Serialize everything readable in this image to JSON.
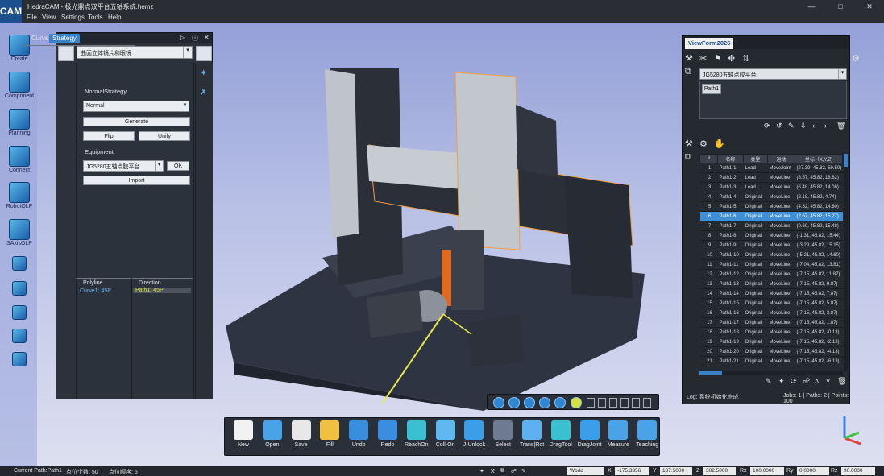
{
  "app": {
    "logo": "CAM",
    "title": "HedraCAM - 极光鼎点双平台五轴系统.hemz",
    "menu": [
      "File",
      "View",
      "Settings",
      "Tools",
      "Help"
    ]
  },
  "left_toolbar": {
    "items": [
      "Create",
      "Component",
      "Planning",
      "Connect",
      "RobotOLP",
      "SAxisOLP"
    ]
  },
  "strategy_panel": {
    "top_select": "曲面立体镜片和眼镜",
    "tabs": [
      "Curve",
      "Strategy"
    ],
    "active_tab": "Strategy",
    "normal_strategy_label": "NormalStrategy",
    "normal_value": "Normal",
    "generate_label": "Generate",
    "flip_label": "Flip",
    "unify_label": "Unify",
    "equipment_label": "Equipment",
    "equipment_value": "JG5280五轴点胶平台",
    "ok_label": "OK",
    "import_label": "Import",
    "polyline_header": "Polyline",
    "polyline_value": "Curve1; 45P",
    "direction_header": "Direction",
    "direction_value": "Path1; 45P"
  },
  "view_form": {
    "tab_label": "ViewForm2026",
    "close_label": "×",
    "equipment_select": "JG5280五轴点胶平台",
    "path_button": "Path1",
    "columns": [
      "#",
      "名称",
      "类型",
      "运动",
      "坐标（X,Y,Z)"
    ],
    "rows": [
      {
        "n": "1",
        "name": "Path1-1",
        "type": "Lead",
        "motion": "MoveJoint",
        "coord": "(27.39, 45.82, 59.50)"
      },
      {
        "n": "2",
        "name": "Path1-2",
        "type": "Lead",
        "motion": "MoveLine",
        "coord": "(8.57, 45.82, 18.62)"
      },
      {
        "n": "3",
        "name": "Path1-3",
        "type": "Lead",
        "motion": "MoveLine",
        "coord": "(6.48, 45.82, 14.08)"
      },
      {
        "n": "4",
        "name": "Path1-4",
        "type": "Original",
        "motion": "MoveLine",
        "coord": "(2.18, 45.82, 4.74)"
      },
      {
        "n": "5",
        "name": "Path1-5",
        "type": "Original",
        "motion": "MoveLine",
        "coord": "(4.62, 45.82, 14.80)"
      },
      {
        "n": "6",
        "name": "Path1-6",
        "type": "Original",
        "motion": "MoveLine",
        "coord": "(2.67, 45.82, 15.27)"
      },
      {
        "n": "7",
        "name": "Path1-7",
        "type": "Original",
        "motion": "MoveLine",
        "coord": "(0.69, 45.82, 15.48)"
      },
      {
        "n": "8",
        "name": "Path1-8",
        "type": "Original",
        "motion": "MoveLine",
        "coord": "(-1.31, 45.82, 15.44)"
      },
      {
        "n": "9",
        "name": "Path1-9",
        "type": "Original",
        "motion": "MoveLine",
        "coord": "(-3.29, 45.82, 15.15)"
      },
      {
        "n": "10",
        "name": "Path1-10",
        "type": "Original",
        "motion": "MoveLine",
        "coord": "(-5.21, 45.82, 14.60)"
      },
      {
        "n": "11",
        "name": "Path1-11",
        "type": "Original",
        "motion": "MoveLine",
        "coord": "(-7.04, 45.82, 13.81)"
      },
      {
        "n": "12",
        "name": "Path1-12",
        "type": "Original",
        "motion": "MoveLine",
        "coord": "(-7.15, 45.82, 11.87)"
      },
      {
        "n": "13",
        "name": "Path1-13",
        "type": "Original",
        "motion": "MoveLine",
        "coord": "(-7.15, 45.82, 9.87)"
      },
      {
        "n": "14",
        "name": "Path1-14",
        "type": "Original",
        "motion": "MoveLine",
        "coord": "(-7.15, 45.82, 7.87)"
      },
      {
        "n": "15",
        "name": "Path1-15",
        "type": "Original",
        "motion": "MoveLine",
        "coord": "(-7.15, 45.82, 5.87)"
      },
      {
        "n": "16",
        "name": "Path1-16",
        "type": "Original",
        "motion": "MoveLine",
        "coord": "(-7.15, 45.82, 3.87)"
      },
      {
        "n": "17",
        "name": "Path1-17",
        "type": "Original",
        "motion": "MoveLine",
        "coord": "(-7.15, 45.82, 1.87)"
      },
      {
        "n": "18",
        "name": "Path1-18",
        "type": "Original",
        "motion": "MoveLine",
        "coord": "(-7.15, 45.82, -0.13)"
      },
      {
        "n": "19",
        "name": "Path1-19",
        "type": "Original",
        "motion": "MoveLine",
        "coord": "(-7.15, 45.82, -2.13)"
      },
      {
        "n": "20",
        "name": "Path1-20",
        "type": "Original",
        "motion": "MoveLine",
        "coord": "(-7.15, 45.82, -4.13)"
      },
      {
        "n": "21",
        "name": "Path1-21",
        "type": "Original",
        "motion": "MoveLine",
        "coord": "(-7.15, 45.82, -6.13)"
      }
    ],
    "selected_row": 5,
    "log_text": "Log:  系统初始化完成",
    "jobs_text": "Jobs: 1 | Paths: 2 | Points: 100"
  },
  "bottom_toolbar": {
    "items": [
      "New",
      "Open",
      "Save",
      "Fill",
      "Undo",
      "Redo",
      "ReachOn",
      "Coll-On",
      "J-Unlock",
      "Select",
      "Trans|Rot",
      "DragTool",
      "DragJoint",
      "Measure",
      "Teaching"
    ]
  },
  "status_bar": {
    "current_path": "Current Path:Path1",
    "point_count": "点位个数: 50",
    "point_order": "点位顺序: 6",
    "coord_frame": "World",
    "x_label": "X",
    "x_value": "-175.3356",
    "y_label": "Y",
    "y_value": "137.5000",
    "z_label": "Z",
    "z_value": "302.5000",
    "rx_label": "Rx",
    "rx_value": "100.0000",
    "ry_label": "Ry",
    "ry_value": "0.0000",
    "rz_label": "Rz",
    "rz_value": "90.0000"
  },
  "colors": {
    "accent": "#3a82c7",
    "panel_bg": "#2c323c",
    "selected_row": "#3e8fd6",
    "path_line": "#e8e84a",
    "highlight_outline": "#f0a040"
  }
}
